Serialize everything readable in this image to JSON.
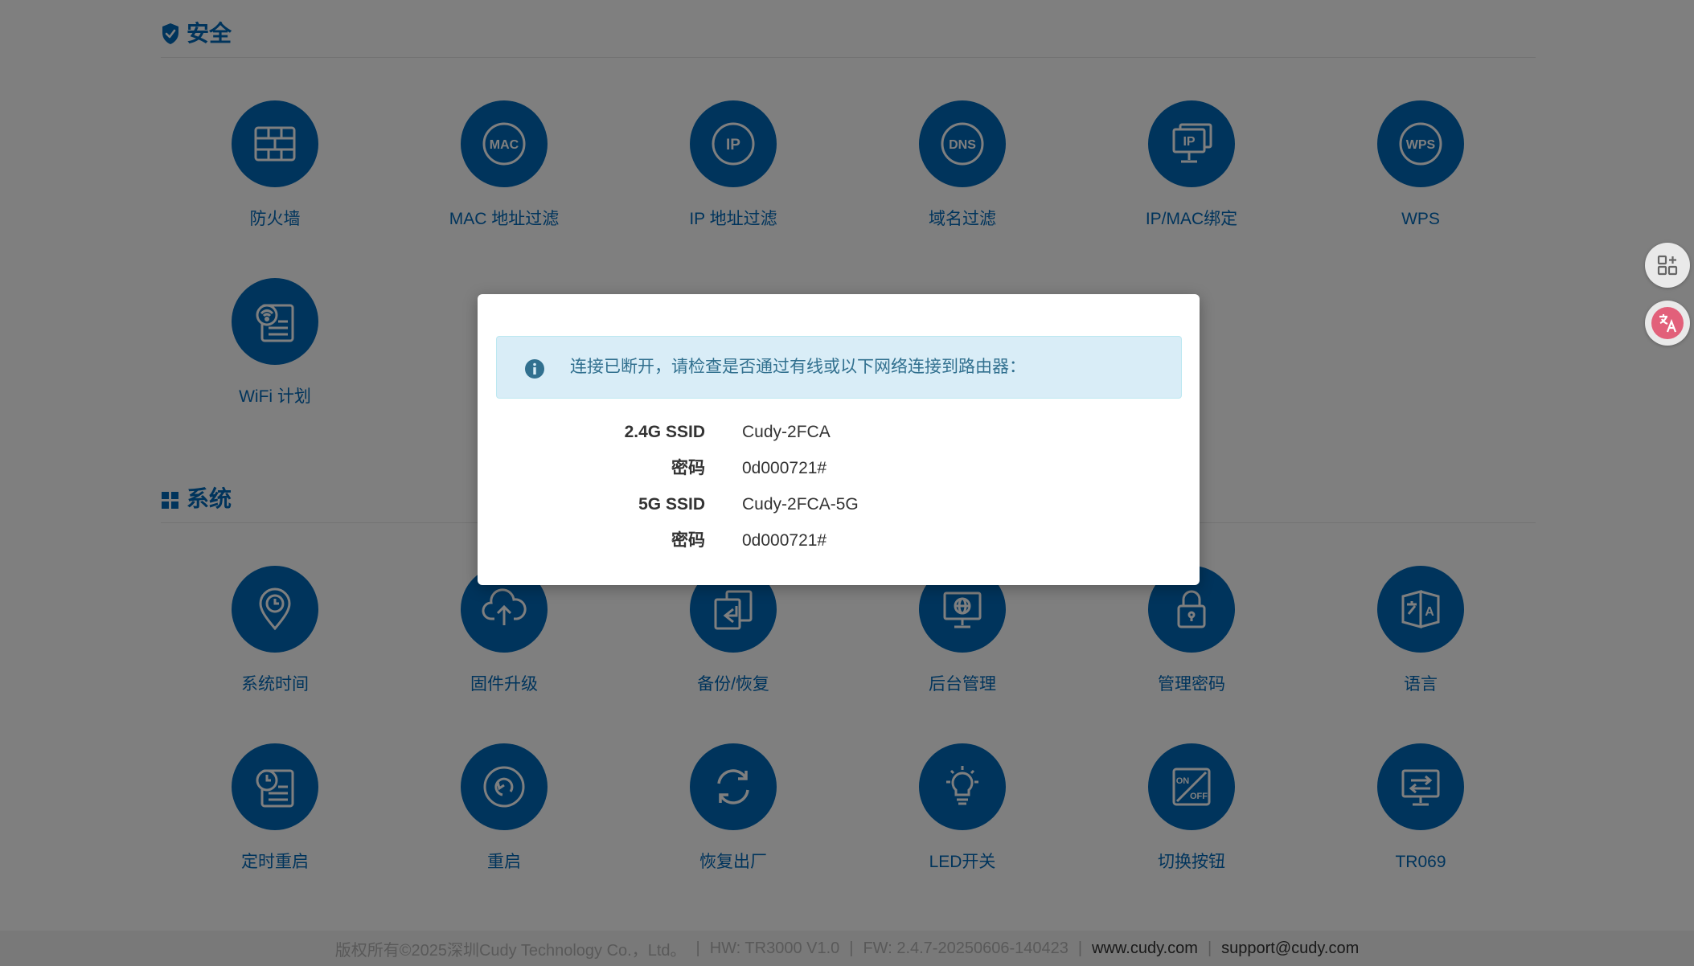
{
  "security": {
    "title": "安全",
    "icon": "shield-check-icon",
    "items": [
      {
        "label": "防火墙",
        "icon": "firewall-icon"
      },
      {
        "label": "MAC 地址过滤",
        "icon": "mac-filter-icon"
      },
      {
        "label": "IP 地址过滤",
        "icon": "ip-filter-icon"
      },
      {
        "label": "域名过滤",
        "icon": "dns-filter-icon"
      },
      {
        "label": "IP/MAC绑定",
        "icon": "ip-mac-binding-icon"
      },
      {
        "label": "WPS",
        "icon": "wps-icon"
      },
      {
        "label": "WiFi 计划",
        "icon": "wifi-schedule-icon"
      }
    ]
  },
  "system": {
    "title": "系统",
    "icon": "grid-icon",
    "items": [
      {
        "label": "系统时间",
        "icon": "location-clock-icon"
      },
      {
        "label": "固件升级",
        "icon": "cloud-upload-icon"
      },
      {
        "label": "备份/恢复",
        "icon": "backup-restore-icon"
      },
      {
        "label": "后台管理",
        "icon": "remote-management-icon"
      },
      {
        "label": "管理密码",
        "icon": "lock-icon"
      },
      {
        "label": "语言",
        "icon": "language-icon"
      },
      {
        "label": "定时重启",
        "icon": "scheduled-reboot-icon"
      },
      {
        "label": "重启",
        "icon": "reboot-icon"
      },
      {
        "label": "恢复出厂",
        "icon": "factory-reset-icon"
      },
      {
        "label": "LED开关",
        "icon": "led-bulb-icon"
      },
      {
        "label": "切换按钮",
        "icon": "on-off-switch-icon"
      },
      {
        "label": "TR069",
        "icon": "tr069-icon"
      }
    ]
  },
  "modal": {
    "alert": "连接已断开，请检查是否通过有线或以下网络连接到路由器：",
    "rows": [
      {
        "key": "2.4G SSID",
        "value": "Cudy-2FCA"
      },
      {
        "key": "密码",
        "value": "0d000721#"
      },
      {
        "key": "5G SSID",
        "value": "Cudy-2FCA-5G"
      },
      {
        "key": "密码",
        "value": "0d000721#"
      }
    ]
  },
  "footer": {
    "copyright": "版权所有©2025深圳Cudy Technology Co.，Ltd。",
    "hw": "HW: TR3000 V1.0",
    "fw": "FW: 2.4.7-20250606-140423",
    "website": "www.cudy.com",
    "email": "support@cudy.com"
  },
  "floating": {
    "apps": "apps-icon",
    "translate": "translate-icon"
  },
  "colors": {
    "brand": "#0068b8",
    "alert_bg": "#d9edf7",
    "alert_text": "#31708f",
    "translate_badge": "#e2607a"
  }
}
